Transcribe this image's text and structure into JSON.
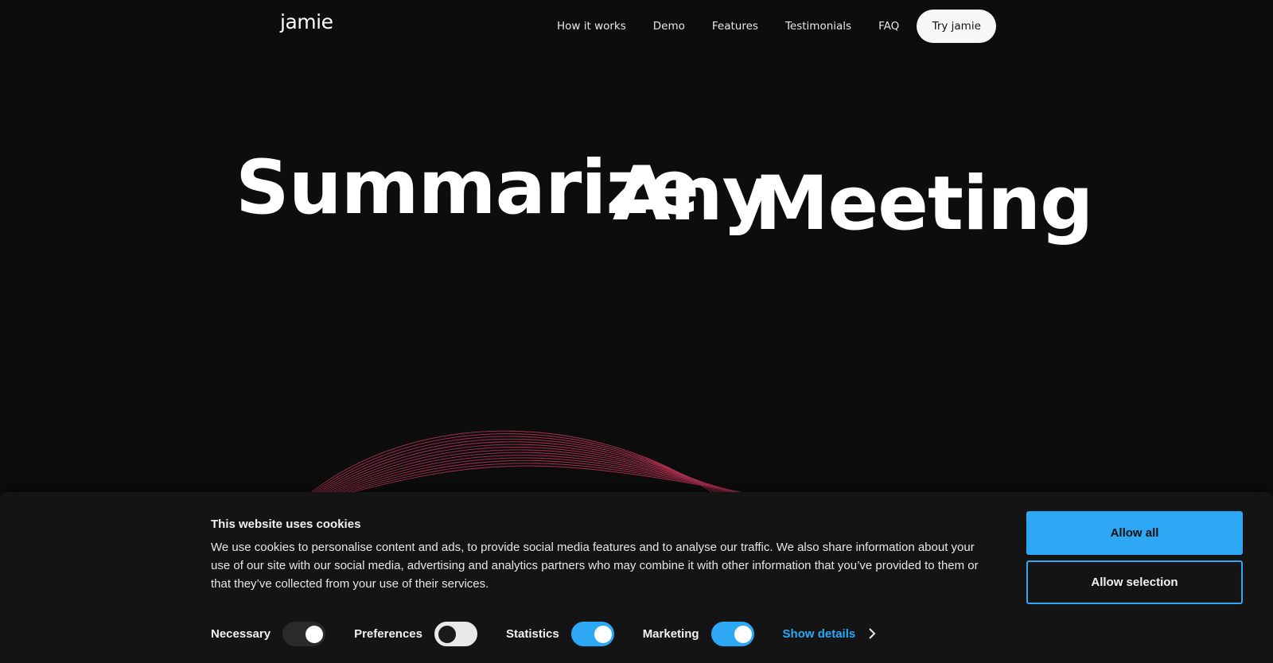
{
  "nav": {
    "logo": "jamie",
    "links": [
      "How it works",
      "Demo",
      "Features",
      "Testimonials",
      "FAQ"
    ],
    "cta_label": "Try jamie"
  },
  "hero": {
    "words": [
      "Summarize",
      "Any",
      "Meeting"
    ]
  },
  "cookie_banner": {
    "title": "This website uses cookies",
    "body": "We use cookies to personalise content and ads, to provide social media features and to analyse our traffic. We also share information about your use of our site with our social media, advertising and analytics partners who may combine it with other information that you’ve provided to them or that they’ve collected from your use of their services.",
    "toggles": [
      {
        "label": "Necessary",
        "state": "on-locked"
      },
      {
        "label": "Preferences",
        "state": "off"
      },
      {
        "label": "Statistics",
        "state": "on"
      },
      {
        "label": "Marketing",
        "state": "on"
      }
    ],
    "show_details_label": "Show details",
    "allow_all_label": "Allow all",
    "allow_selection_label": "Allow selection"
  },
  "colors": {
    "background": "#0d0d0d",
    "accent": "#2ea7f5",
    "wave": "#c8385a"
  }
}
